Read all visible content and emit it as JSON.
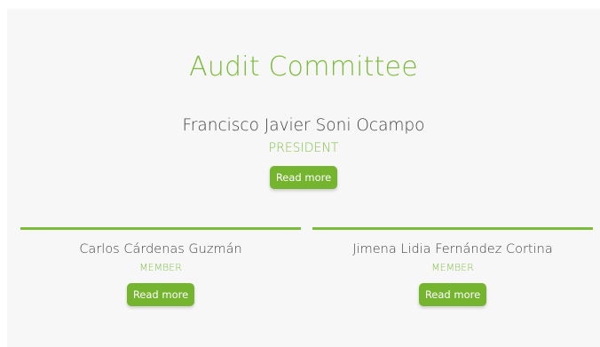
{
  "section": {
    "title": "Audit Committee"
  },
  "president": {
    "name": "Francisco Javier Soni Ocampo",
    "role": "PRESIDENT",
    "button_label": "Read more"
  },
  "members": [
    {
      "name": "Carlos Cárdenas Guzmán",
      "role": "MEMBER",
      "button_label": "Read more"
    },
    {
      "name": "Jimena Lidia Fernández Cortina",
      "role": "MEMBER",
      "button_label": "Read more"
    }
  ],
  "colors": {
    "accent": "#7dbb3b",
    "button": "#75b42f",
    "text": "#444444",
    "panel": "#f7f7f7"
  }
}
